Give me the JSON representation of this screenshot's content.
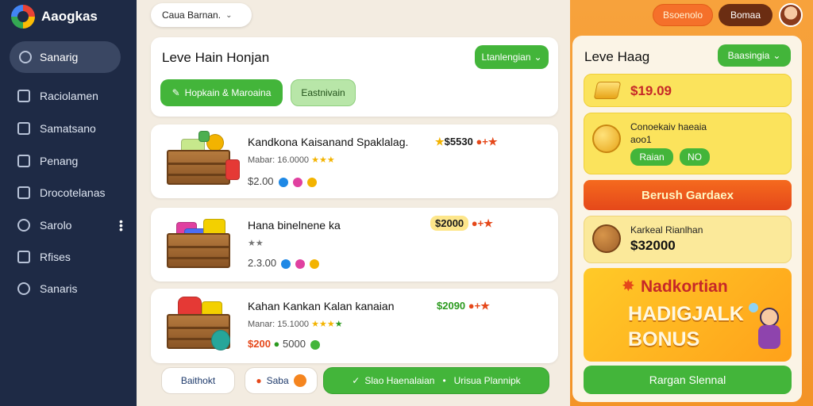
{
  "app": {
    "name": "Aaogkas"
  },
  "sidebar": {
    "active": {
      "label": "Sanarig"
    },
    "items": [
      {
        "label": "Raciolamen"
      },
      {
        "label": "Samatsano"
      },
      {
        "label": "Penang"
      },
      {
        "label": "Drocotelanas"
      },
      {
        "label": "Sarolo"
      },
      {
        "label": "Rfises"
      },
      {
        "label": "Sanaris"
      }
    ]
  },
  "search": {
    "value": "Caua Barnan."
  },
  "panel": {
    "title": "Leve Hain Honjan",
    "dropdown": "Ltanlengian",
    "filter_primary": "Hopkain & Maroaina",
    "filter_secondary": "Eastnivain"
  },
  "items": [
    {
      "name": "Kandkona Kaisanand Spaklalag.",
      "sub": "Mabar: 16.0000",
      "price": "$2.00",
      "tag": "$5530",
      "tag_color": "#1b1b1b"
    },
    {
      "name": "Hana binelnene ka",
      "sub": "",
      "price": "2.3.00",
      "tag": "$2000",
      "tag_color": "#1b1b1b"
    },
    {
      "name": "Kahan Kankan Kalan kanaian",
      "sub": "Manar: 15.1000",
      "price": "$200",
      "price2": "5000",
      "tag": "$2090",
      "tag_color": "#2b9a1f"
    }
  ],
  "toolbar": {
    "btn1": "Baithokt",
    "btn2": "Saba",
    "btn3_left": "Slao Haenalaian",
    "btn3_right": "Urisua Plannipk"
  },
  "header": {
    "pill1": "Bsoenolo",
    "pill2": "Bomaa"
  },
  "right": {
    "title": "Leve Haag",
    "dropdown": "Baasingia",
    "coins": "$19.09",
    "offer_text": "Conoekaiv haeaia",
    "offer_sub": "aoo1",
    "offer_yes": "Raian",
    "offer_no": "NO",
    "banner": "Berush Gardaex",
    "reward_label": "Karkeal Rianlhan",
    "reward_value": "$32000",
    "bonus_line1": "Nadkortian",
    "bonus_line2": "HADIGJALK",
    "bonus_line3": "BONUS",
    "claim": "Rargan Slennal"
  },
  "colors": {
    "sidebar": "#1e2a45",
    "accent_green": "#43b53a",
    "accent_orange": "#f39427"
  }
}
